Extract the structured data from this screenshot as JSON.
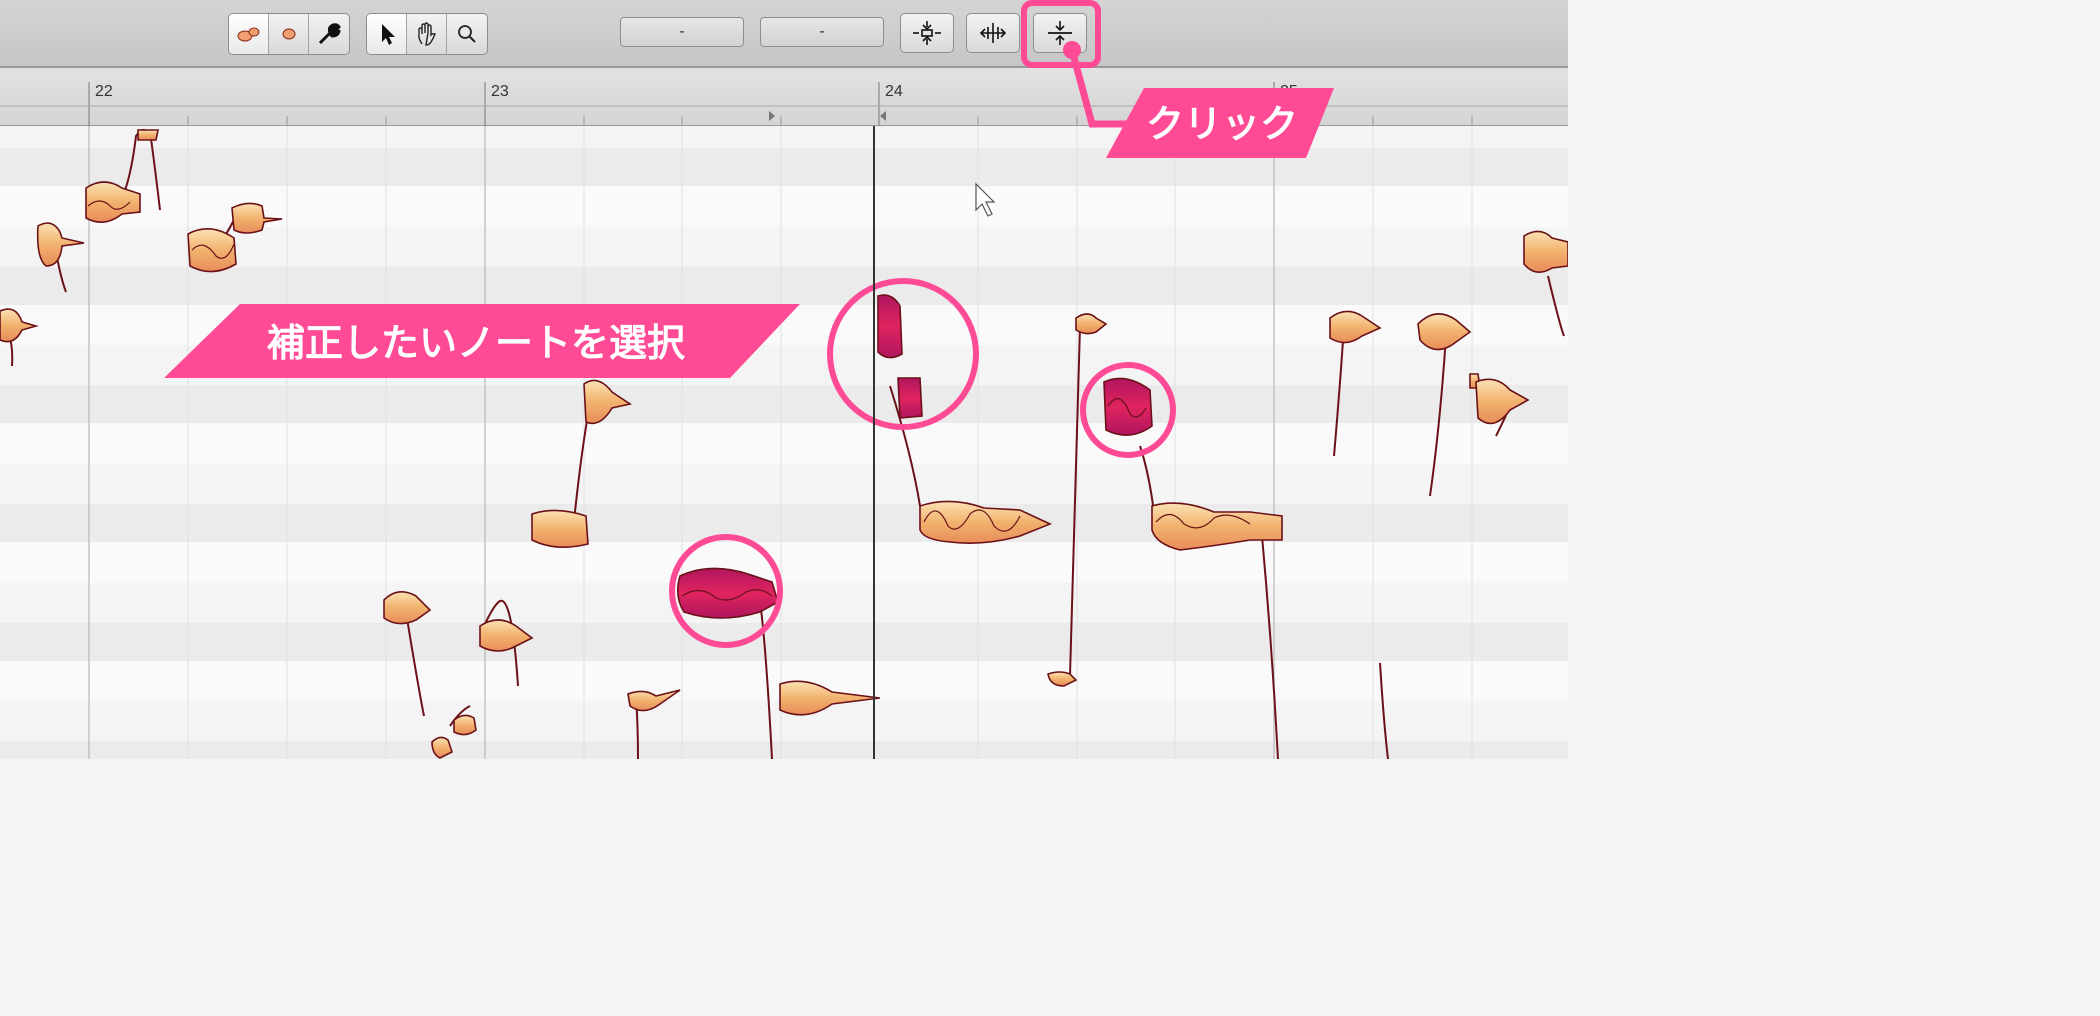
{
  "toolbar": {
    "field1_value": "-",
    "field2_value": "-",
    "mode_buttons": [
      "blob-main-tool-icon",
      "blob-secondary-tool-icon",
      "wrench-tool-icon"
    ],
    "nav_buttons": [
      "arrow-pointer-icon",
      "hand-icon",
      "magnifier-icon"
    ],
    "pitch_buttons": [
      "center-pitch-icon",
      "pitch-drift-icon",
      "pitch-modulation-icon"
    ]
  },
  "ruler": {
    "bars": [
      "22",
      "23",
      "24",
      "25"
    ]
  },
  "callouts": {
    "click_label": "クリック",
    "select_label": "補正したいノートを選択"
  },
  "colors": {
    "accent_pink": "#ff4a96",
    "note_light": "#f6c98a",
    "note_dark": "#c2185b",
    "note_outline": "#6b1118"
  }
}
